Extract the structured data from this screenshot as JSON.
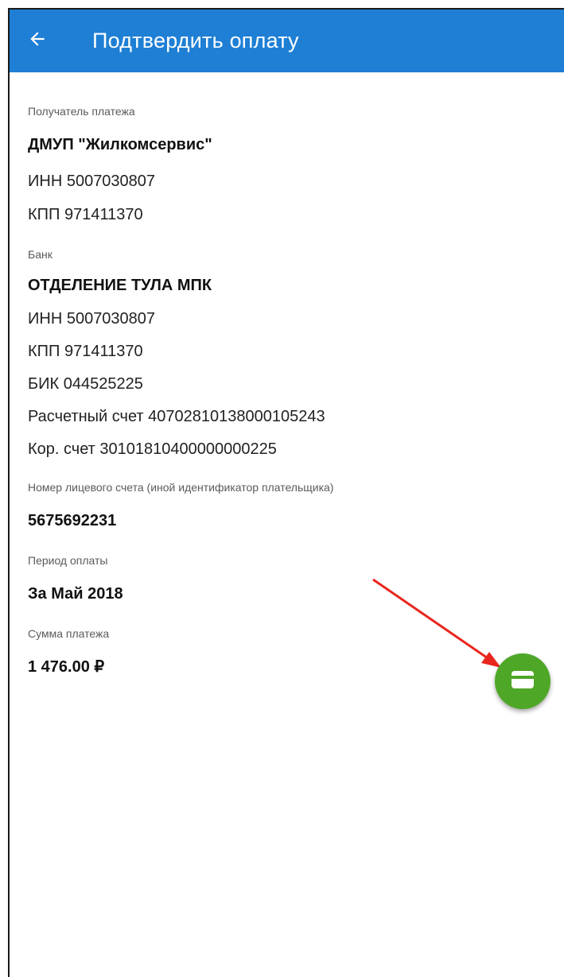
{
  "appbar": {
    "title": "Подтвердить оплату",
    "back_icon": "arrow-back-icon",
    "color": "#1e7fd5"
  },
  "recipient": {
    "label": "Получатель платежа",
    "name": "ДМУП \"Жилкомсервис\"",
    "inn": "ИНН 5007030807",
    "kpp": "КПП 971411370"
  },
  "bank": {
    "label": "Банк",
    "name": "ОТДЕЛЕНИЕ ТУЛА  МПК",
    "inn": "ИНН 5007030807",
    "kpp": "КПП 971411370",
    "bik": "БИК 044525225",
    "account": "Расчетный счет 40702810138000105243",
    "corr_account": "Кор. счет 30101810400000000225"
  },
  "payer": {
    "label": "Номер лицевого счета (иной идентификатор плательщика)",
    "value": "5675692231"
  },
  "period": {
    "label": "Период оплаты",
    "value": "За Май 2018"
  },
  "amount": {
    "label": "Сумма платежа",
    "value": "1 476.00 ₽"
  },
  "fab": {
    "icon": "credit-card-icon",
    "color": "#4ea726"
  },
  "annotation": {
    "arrow_color": "#e8261e"
  }
}
